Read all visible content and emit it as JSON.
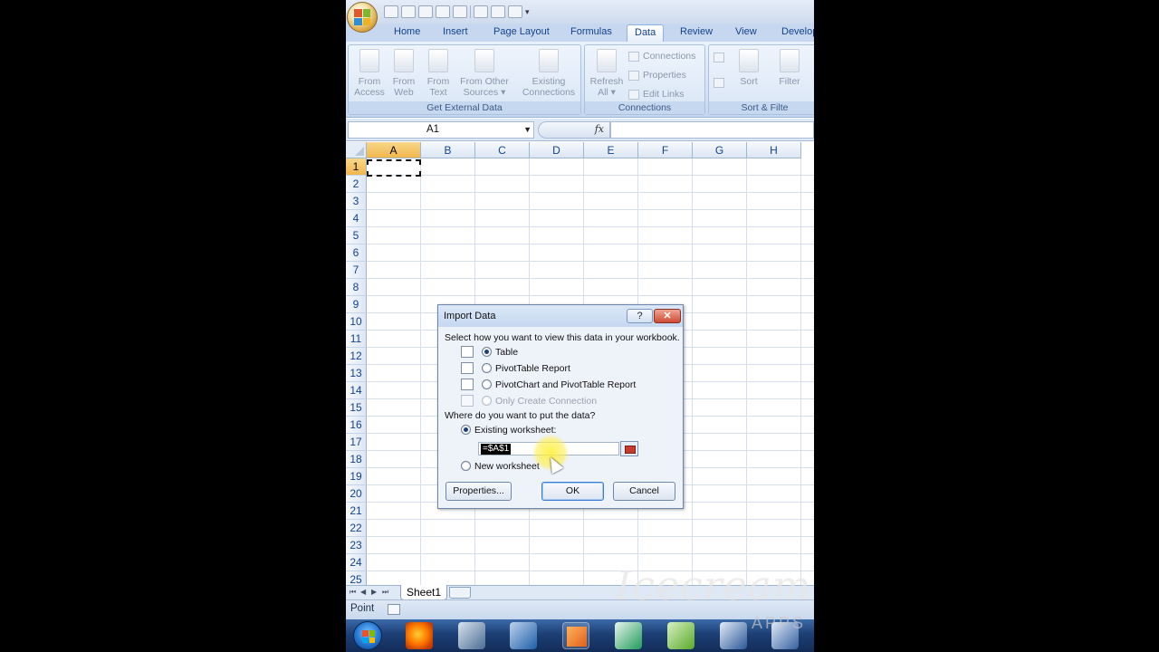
{
  "ribbon_tabs": [
    "Home",
    "Insert",
    "Page Layout",
    "Formulas",
    "Data",
    "Review",
    "View",
    "Develop"
  ],
  "active_tab": "Data",
  "groups": {
    "get_external": {
      "label": "Get External Data",
      "buttons": [
        {
          "line1": "From",
          "line2": "Access"
        },
        {
          "line1": "From",
          "line2": "Web"
        },
        {
          "line1": "From",
          "line2": "Text"
        },
        {
          "line1": "From Other",
          "line2": "Sources ▾"
        },
        {
          "line1": "Existing",
          "line2": "Connections"
        }
      ]
    },
    "connections": {
      "label": "Connections",
      "refresh": {
        "line1": "Refresh",
        "line2": "All ▾"
      },
      "items": [
        "Connections",
        "Properties",
        "Edit Links"
      ]
    },
    "sort_filter": {
      "label": "Sort & Filte",
      "sort": "Sort",
      "filter": "Filter"
    }
  },
  "formula_bar": {
    "name_box": "A1",
    "fx": "fx",
    "formula": ""
  },
  "columns": [
    "A",
    "B",
    "C",
    "D",
    "E",
    "F",
    "G",
    "H"
  ],
  "rows": [
    "1",
    "2",
    "3",
    "4",
    "5",
    "6",
    "7",
    "8",
    "9",
    "10",
    "11",
    "12",
    "13",
    "14",
    "15",
    "16",
    "17",
    "18",
    "19",
    "20",
    "21",
    "22",
    "23",
    "24",
    "25"
  ],
  "sheet_tab": "Sheet1",
  "status": "Point",
  "dialog": {
    "title": "Import Data",
    "help": "?",
    "close": "✕",
    "prompt_view": "Select how you want to view this data in your workbook.",
    "view_options": [
      {
        "label": "Table",
        "selected": true,
        "disabled": false
      },
      {
        "label": "PivotTable Report",
        "selected": false,
        "disabled": false
      },
      {
        "label": "PivotChart and PivotTable Report",
        "selected": false,
        "disabled": false
      },
      {
        "label": "Only Create Connection",
        "selected": false,
        "disabled": true
      }
    ],
    "prompt_location": "Where do you want to put the data?",
    "location_options": [
      {
        "label": "Existing worksheet:",
        "selected": true
      },
      {
        "label": "New worksheet",
        "selected": false
      }
    ],
    "reference": "=$A$1",
    "buttons": {
      "properties": "Properties...",
      "ok": "OK",
      "cancel": "Cancel"
    }
  },
  "watermark": {
    "text": "Icecream",
    "sub": "APPS"
  }
}
